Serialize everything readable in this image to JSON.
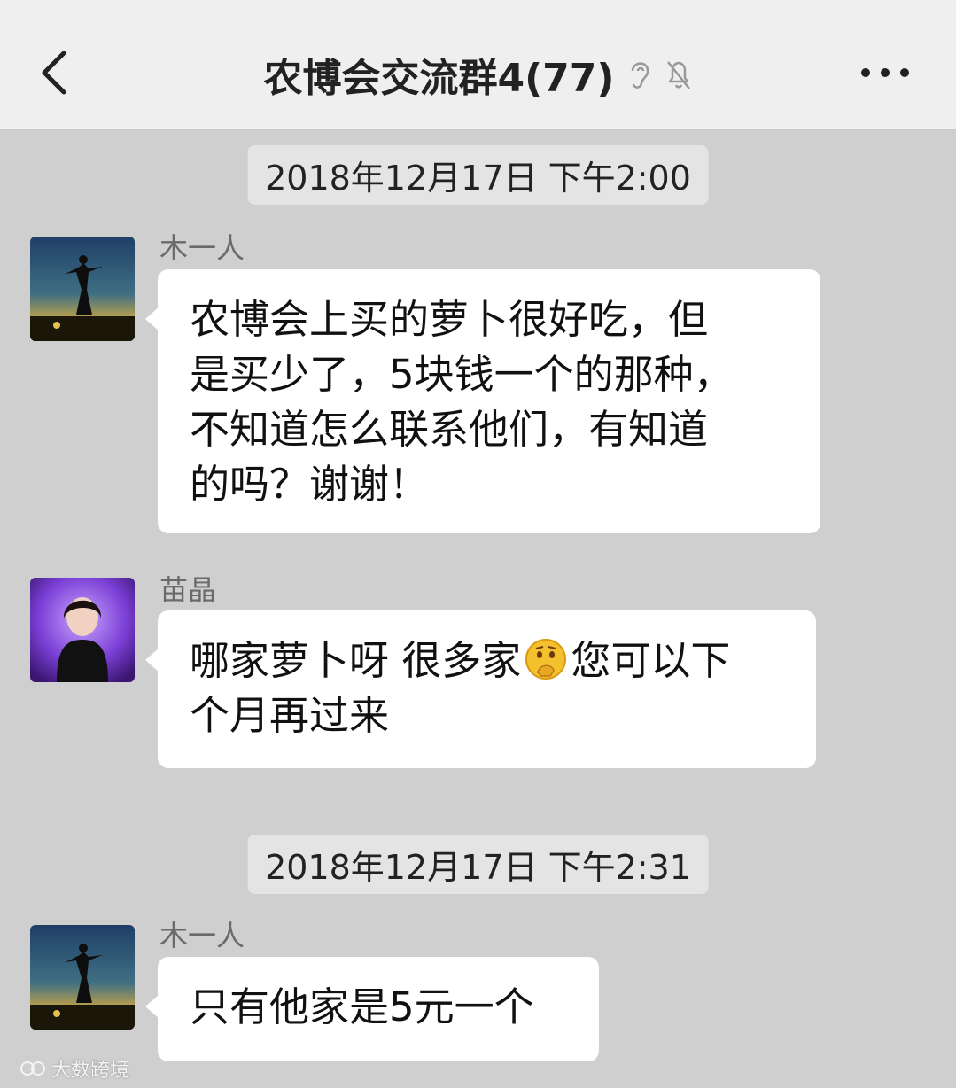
{
  "header": {
    "title": "农博会交流群4(77)",
    "back_icon": "chevron-left-icon",
    "ear_icon": "ear-icon",
    "mute_icon": "bell-muted-icon",
    "more_icon": "more-dots-icon"
  },
  "messages": [
    {
      "type": "timestamp",
      "text": "2018年12月17日  下午2:00"
    },
    {
      "type": "message",
      "sender": "木一人",
      "avatar": "ballet-dancer-sunset-avatar",
      "lines": [
        "农博会上买的萝卜很好吃，但",
        "是买少了，5块钱一个的那种，",
        "不知道怎么联系他们，有知道",
        "的吗？谢谢！"
      ]
    },
    {
      "type": "message",
      "sender": "苗晶",
      "avatar": "woman-purple-background-avatar",
      "lines_before_emoji": "哪家萝卜呀 很多家",
      "emoji": "thinking-face-emoji",
      "lines_after_emoji": "您可以下",
      "line2": "个月再过来"
    },
    {
      "type": "timestamp",
      "text": "2018年12月17日  下午2:31"
    },
    {
      "type": "message",
      "sender": "木一人",
      "avatar": "ballet-dancer-sunset-avatar",
      "lines": [
        "只有他家是5元一个"
      ]
    }
  ],
  "watermark": {
    "text": "大数跨境",
    "icon": "logo-icon"
  },
  "colors": {
    "chat_bg": "#cfcfcf",
    "bubble_bg": "#ffffff",
    "header_bg": "#efefef",
    "timestamp_bg": "#e4e4e4"
  }
}
